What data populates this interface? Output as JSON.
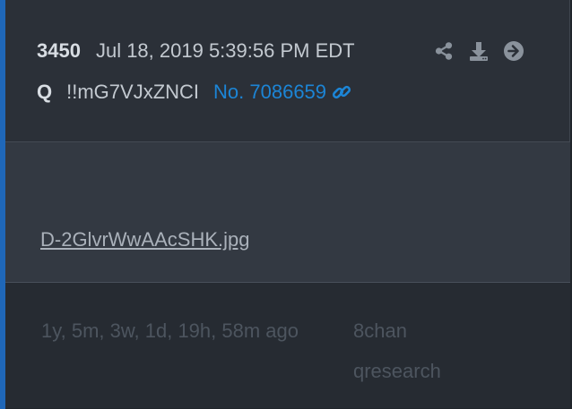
{
  "post": {
    "number": "3450",
    "timestamp": "Jul 18, 2019 5:39:56 PM EDT",
    "author": "Q",
    "tripcode": "!!mG7VJxZNCI",
    "post_link": "No. 7086659"
  },
  "actions": {
    "share_icon": "share-icon",
    "download_icon": "download-icon",
    "go_icon": "arrow-circle-right-icon"
  },
  "attachment": {
    "filename": "D-2GlvrWwAAcSHK.jpg"
  },
  "footer": {
    "time_ago": "1y, 5m, 3w, 1d, 19h, 58m ago",
    "source": "8chan qresearch"
  },
  "colors": {
    "accent": "#1f67b8",
    "link": "#1c85d6",
    "card_bg": "#2b3038",
    "footer_bg": "#262b32"
  }
}
